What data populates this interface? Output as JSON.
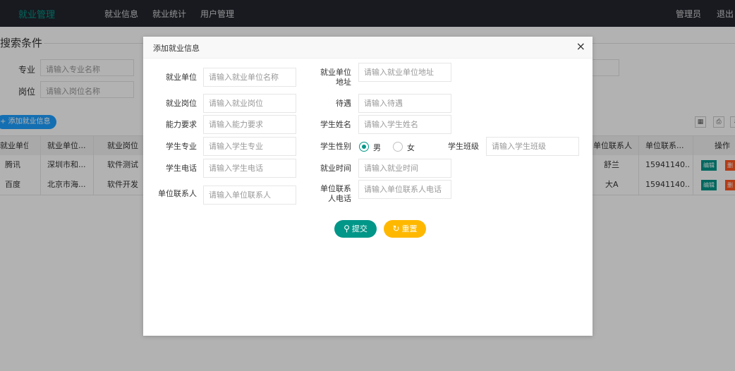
{
  "nav": {
    "brand": "就业管理",
    "items": [
      "就业信息",
      "就业统计",
      "用户管理"
    ],
    "admin": "管理员",
    "logout": "退出"
  },
  "search": {
    "title": "搜索条件",
    "major_label": "专业",
    "major_placeholder": "请输入专业名称",
    "post_label": "岗位",
    "post_placeholder": "请输入岗位名称"
  },
  "toolbar": {
    "add_label": "+ 添加就业信息"
  },
  "table": {
    "headers": [
      "就业单位",
      "就业单位...",
      "就业岗位",
      "单位联系人",
      "单位联系...",
      "操作"
    ],
    "rows": [
      {
        "unit": "腾讯",
        "addr": "深圳市和...",
        "post": "软件测试",
        "contact": "舒兰",
        "phone": "15941140...",
        "edit": "编辑",
        "del": "删"
      },
      {
        "unit": "百度",
        "addr": "北京市海...",
        "post": "软件开发",
        "contact": "大A",
        "phone": "15941140...",
        "edit": "编辑",
        "del": "删"
      }
    ]
  },
  "modal": {
    "title": "添加就业信息",
    "close": "×",
    "fields": {
      "company": {
        "label": "就业单位",
        "placeholder": "请输入就业单位名称"
      },
      "address": {
        "label": "就业单位地址",
        "placeholder": "请输入就业单位地址"
      },
      "position": {
        "label": "就业岗位",
        "placeholder": "请输入就业岗位"
      },
      "salary": {
        "label": "待遇",
        "placeholder": "请输入待遇"
      },
      "ability": {
        "label": "能力要求",
        "placeholder": "请输入能力要求"
      },
      "student_name": {
        "label": "学生姓名",
        "placeholder": "请输入学生姓名"
      },
      "student_major": {
        "label": "学生专业",
        "placeholder": "请输入学生专业"
      },
      "gender": {
        "label": "学生性别",
        "male": "男",
        "female": "女",
        "selected": "男"
      },
      "student_class": {
        "label": "学生班级",
        "placeholder": "请输入学生班级"
      },
      "student_phone": {
        "label": "学生电话",
        "placeholder": "请输入学生电话"
      },
      "employ_time": {
        "label": "就业时间",
        "placeholder": "请输入就业时间"
      },
      "contact": {
        "label": "单位联系人",
        "placeholder": "请输入单位联系人"
      },
      "contact_phone": {
        "label": "单位联系人电话",
        "placeholder": "请输入单位联系人电话"
      }
    },
    "submit": "提交",
    "reset": "重置"
  },
  "colors": {
    "primary": "#009688",
    "warm": "#ffb800",
    "blue": "#1e9fff",
    "danger": "#ff5722"
  }
}
